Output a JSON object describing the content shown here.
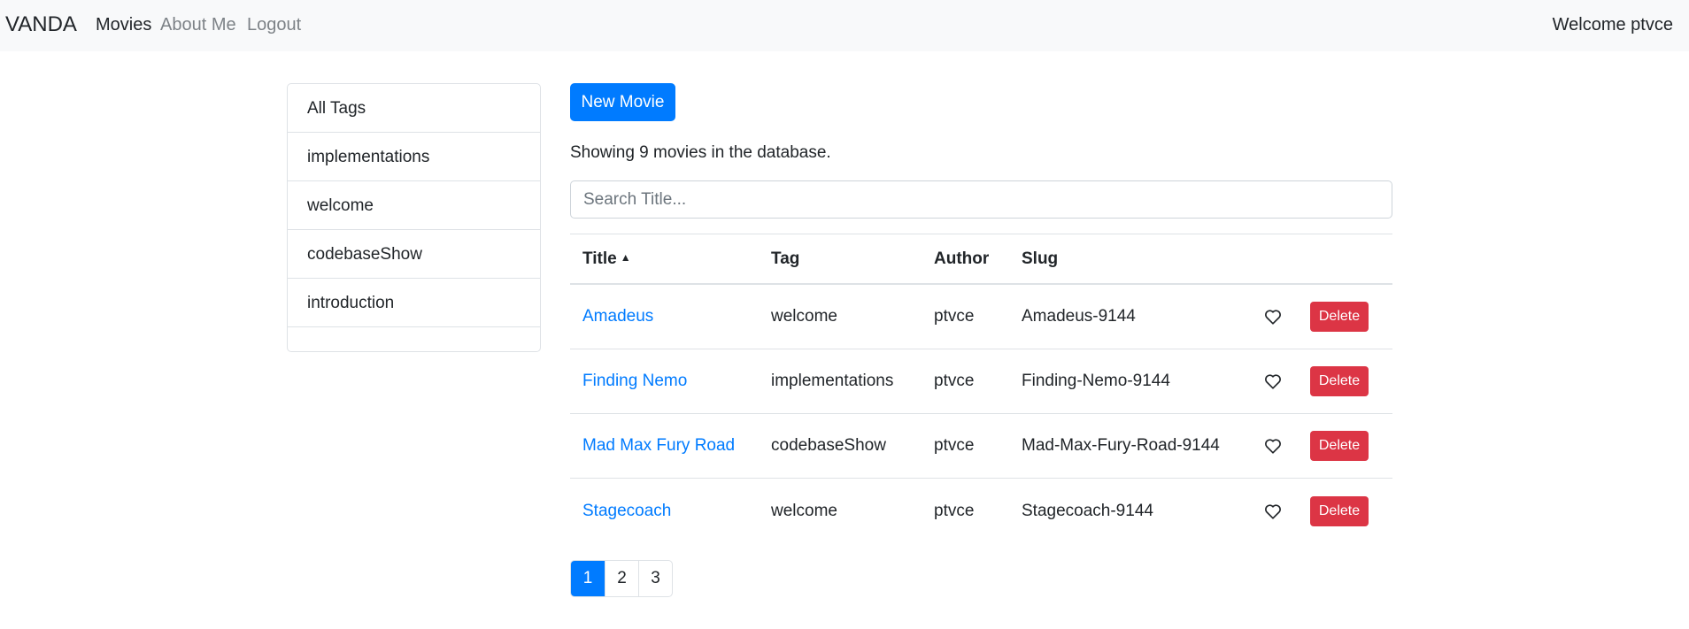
{
  "navbar": {
    "brand": "VANDA",
    "links": [
      {
        "label": "Movies"
      },
      {
        "label": "About Me"
      },
      {
        "label": "Logout"
      }
    ],
    "welcome": "Welcome ptvce"
  },
  "tags": [
    "All Tags",
    "implementations",
    "welcome",
    "codebaseShow",
    "introduction"
  ],
  "toolbar": {
    "new_movie_label": "New Movie"
  },
  "status_text": "Showing 9 movies in the database.",
  "search": {
    "placeholder": "Search Title...",
    "value": ""
  },
  "table": {
    "headers": {
      "title": "Title",
      "tag": "Tag",
      "author": "Author",
      "slug": "Slug"
    },
    "sort_indicator": "▲",
    "delete_label": "Delete",
    "rows": [
      {
        "title": "Amadeus",
        "tag": "welcome",
        "author": "ptvce",
        "slug": "Amadeus-9144"
      },
      {
        "title": "Finding Nemo",
        "tag": "implementations",
        "author": "ptvce",
        "slug": "Finding-Nemo-9144"
      },
      {
        "title": "Mad Max Fury Road",
        "tag": "codebaseShow",
        "author": "ptvce",
        "slug": "Mad-Max-Fury-Road-9144"
      },
      {
        "title": "Stagecoach",
        "tag": "welcome",
        "author": "ptvce",
        "slug": "Stagecoach-9144"
      }
    ]
  },
  "pagination": {
    "pages": [
      "1",
      "2",
      "3"
    ],
    "current": "1"
  },
  "colors": {
    "primary": "#007bff",
    "danger": "#dc3545",
    "navbar_bg": "#f8f9fa"
  }
}
